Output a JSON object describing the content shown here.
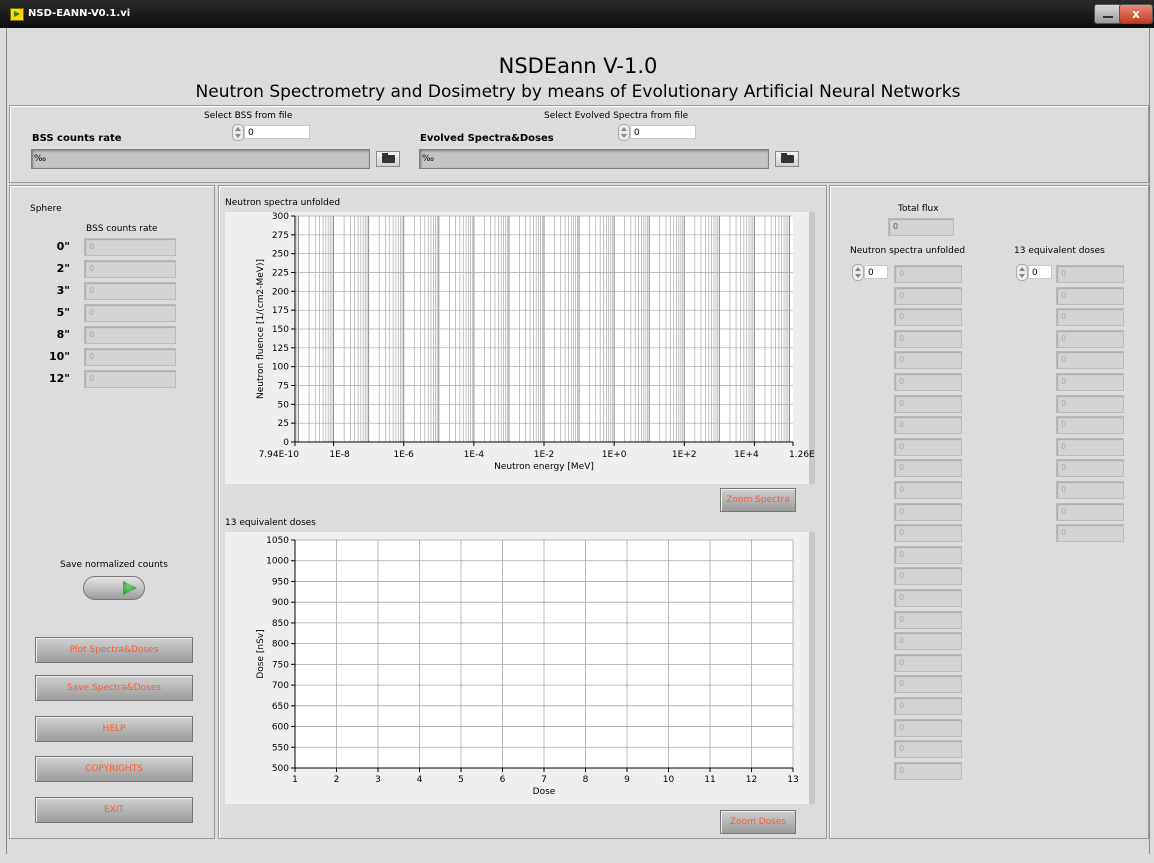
{
  "window": {
    "title": "NSD-EANN-V0.1.vi",
    "close_label": "x"
  },
  "header": {
    "title": "NSDEann V-1.0",
    "subtitle": "Neutron Spectrometry and Dosimetry by means of Evolutionary Artificial Neural Networks"
  },
  "file_panel": {
    "bss_label": "BSS counts rate",
    "select_bss_label": "Select BSS from file",
    "select_bss_value": "0",
    "bss_path": "",
    "evolved_label": "Evolved Spectra&Doses",
    "select_evolved_label": "Select Evolved Spectra from file",
    "select_evolved_value": "0",
    "evolved_path": "",
    "path_glyph": "‰"
  },
  "left_panel": {
    "sphere_label": "Sphere",
    "counts_header": "BSS counts rate",
    "spheres": [
      {
        "label": "0\"",
        "value": "0"
      },
      {
        "label": "2\"",
        "value": "0"
      },
      {
        "label": "3\"",
        "value": "0"
      },
      {
        "label": "5\"",
        "value": "0"
      },
      {
        "label": "8\"",
        "value": "0"
      },
      {
        "label": "10\"",
        "value": "0"
      },
      {
        "label": "12\"",
        "value": "0"
      }
    ],
    "save_normalized_label": "Save normalized counts",
    "buttons": {
      "plot": "Plot Spectra&Doses",
      "save": "Save Spectra&Doses",
      "help": "HELP",
      "copyrights": "COPYRIGHTS",
      "exit": "EXIT"
    }
  },
  "spectra_chart": {
    "title": "Neutron spectra unfolded",
    "xlabel": "Neutron energy [MeV]",
    "ylabel": "Neutron fluence [1/(cm2-MeV)]",
    "y_ticks": [
      "0",
      "25",
      "50",
      "75",
      "100",
      "125",
      "150",
      "175",
      "200",
      "225",
      "250",
      "275",
      "300"
    ],
    "x_tick_labels": [
      "7.94E-10",
      "1E-8",
      "1E-6",
      "1E-4",
      "1E-2",
      "1E+0",
      "1E+2",
      "1E+4",
      "1.26E+5"
    ],
    "zoom_label": "Zoom Spectra"
  },
  "doses_chart": {
    "title": "13 equivalent doses",
    "xlabel": "Dose",
    "ylabel": "Dose [nSv]",
    "y_ticks": [
      "500",
      "550",
      "600",
      "650",
      "700",
      "750",
      "800",
      "850",
      "900",
      "950",
      "1000",
      "1050"
    ],
    "x_ticks": [
      "1",
      "2",
      "3",
      "4",
      "5",
      "6",
      "7",
      "8",
      "9",
      "10",
      "11",
      "12",
      "13"
    ],
    "zoom_label": "Zoom Doses"
  },
  "right_panel": {
    "total_flux_label": "Total flux",
    "total_flux_value": "0",
    "spectra_label": "Neutron spectra unfolded",
    "spectra_index": "0",
    "spectra_values": [
      "0",
      "0",
      "0",
      "0",
      "0",
      "0",
      "0",
      "0",
      "0",
      "0",
      "0",
      "0",
      "0",
      "0",
      "0",
      "0",
      "0",
      "0",
      "0",
      "0",
      "0",
      "0",
      "0",
      "0"
    ],
    "doses_label": "13 equivalent doses",
    "doses_index": "0",
    "doses_values": [
      "0",
      "0",
      "0",
      "0",
      "0",
      "0",
      "0",
      "0",
      "0",
      "0",
      "0",
      "0",
      "0"
    ]
  },
  "chart_data": [
    {
      "type": "line",
      "title": "Neutron spectra unfolded",
      "xlabel": "Neutron energy [MeV]",
      "ylabel": "Neutron fluence [1/(cm2-MeV)]",
      "x_scale": "log",
      "xlim": [
        7.94e-10,
        126000.0
      ],
      "ylim": [
        0,
        300
      ],
      "grid": true,
      "series": []
    },
    {
      "type": "line",
      "title": "13 equivalent doses",
      "xlabel": "Dose",
      "ylabel": "Dose [nSv]",
      "xlim": [
        1,
        13
      ],
      "ylim": [
        500,
        1050
      ],
      "grid": true,
      "series": []
    }
  ]
}
